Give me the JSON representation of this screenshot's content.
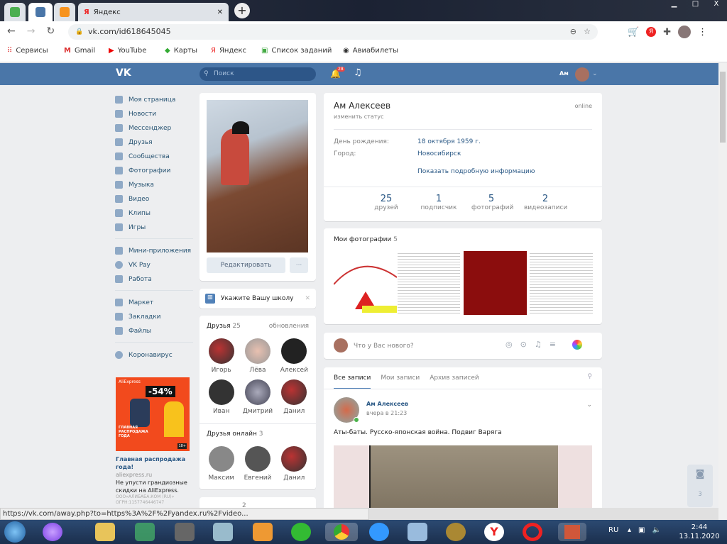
{
  "browser": {
    "tab_active": "Яндекс",
    "url": "vk.com/id618645045",
    "bookmarks": [
      "Сервисы",
      "Gmail",
      "YouTube",
      "Карты",
      "Яндекс",
      "Список заданий",
      "Авиабилеты"
    ],
    "status_url": "https://vk.com/away.php?to=https%3A%2F%2Fyandex.ru%2Fvideo..."
  },
  "vk": {
    "logo": "VK",
    "search_placeholder": "Поиск",
    "notif_count": "28",
    "user_short": "Ам"
  },
  "nav": [
    "Моя страница",
    "Новости",
    "Мессенджер",
    "Друзья",
    "Сообщества",
    "Фотографии",
    "Музыка",
    "Видео",
    "Клипы",
    "Игры"
  ],
  "nav2": [
    "Мини-приложения",
    "VK Pay",
    "Работа"
  ],
  "nav3": [
    "Маркет",
    "Закладки",
    "Файлы"
  ],
  "nav4": [
    "Коронавирус"
  ],
  "ad": {
    "brand": "AliExpress",
    "discount": "-54%",
    "banner": "ГЛАВНАЯ РАСПРОДАЖА ГОДА",
    "age": "18+",
    "title": "Главная распродажа года!",
    "domain": "aliexpress.ru",
    "text": "Не упусти грандиозные скидки на AliExpress.",
    "legal": "ООО«АЛИБАБА.КОМ (RU)» ОГРН:1157746446747"
  },
  "profile": {
    "edit": "Редактировать",
    "more": "···",
    "school": "Укажите Вашу школу",
    "name": "Ам Алексеев",
    "status": "изменить статус",
    "online": "online",
    "bday_label": "День рождения:",
    "bday": "18 октября 1959 г.",
    "city_label": "Город:",
    "city": "Новосибирск",
    "more_info": "Показать подробную информацию",
    "counters": [
      {
        "n": "25",
        "l": "друзей"
      },
      {
        "n": "1",
        "l": "подписчик"
      },
      {
        "n": "5",
        "l": "фотографий"
      },
      {
        "n": "2",
        "l": "видеозаписи"
      }
    ]
  },
  "friends": {
    "title": "Друзья",
    "count": "25",
    "updates": "обновления",
    "list": [
      "Игорь",
      "Лёва",
      "Алексей",
      "Иван",
      "Дмитрий",
      "Данил"
    ],
    "online_title": "Друзья онлайн",
    "online_count": "3",
    "online": [
      "Максим",
      "Евгений",
      "Данил"
    ],
    "next_count": "2"
  },
  "photos": {
    "title": "Мои фотографии",
    "count": "5"
  },
  "composer": {
    "placeholder": "Что у Вас нового?"
  },
  "wall": {
    "tabs": [
      "Все записи",
      "Мои записи",
      "Архив записей"
    ],
    "author": "Ам Алексеев",
    "time": "вчера в 21:23",
    "text": "Аты-баты. Русско-японская война. Подвиг Варяга"
  },
  "side_count": "3",
  "tray": {
    "lang": "RU",
    "time": "2:44",
    "date": "13.11.2020"
  }
}
